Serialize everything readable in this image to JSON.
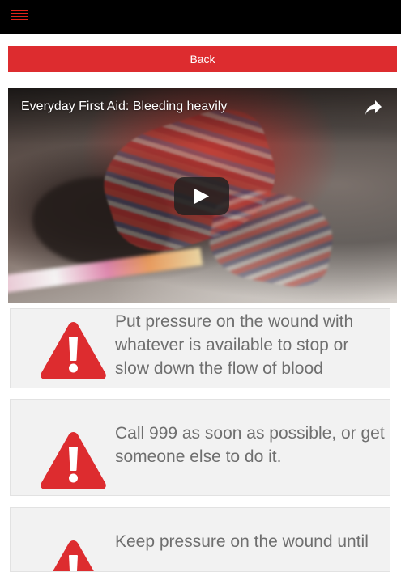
{
  "topbar": {
    "menu_icon": "hamburger-menu-icon"
  },
  "back_button": {
    "label": "Back"
  },
  "video": {
    "title": "Everyday First Aid: Bleeding heavily",
    "share_icon": "share-icon",
    "play_icon": "play-icon"
  },
  "steps": [
    {
      "icon": "warning-icon",
      "text": "Put pressure on the wound with whatever is available to stop or slow down the flow of blood"
    },
    {
      "icon": "warning-icon",
      "text": "Call 999 as soon as possible, or get someone else to do it."
    },
    {
      "icon": "warning-icon",
      "text": "Keep pressure on the wound until"
    }
  ],
  "colors": {
    "brand_red": "#dd2c2f",
    "topbar": "#000000",
    "card_bg": "#f2f2f2",
    "text_gray": "#6f6f6f"
  }
}
